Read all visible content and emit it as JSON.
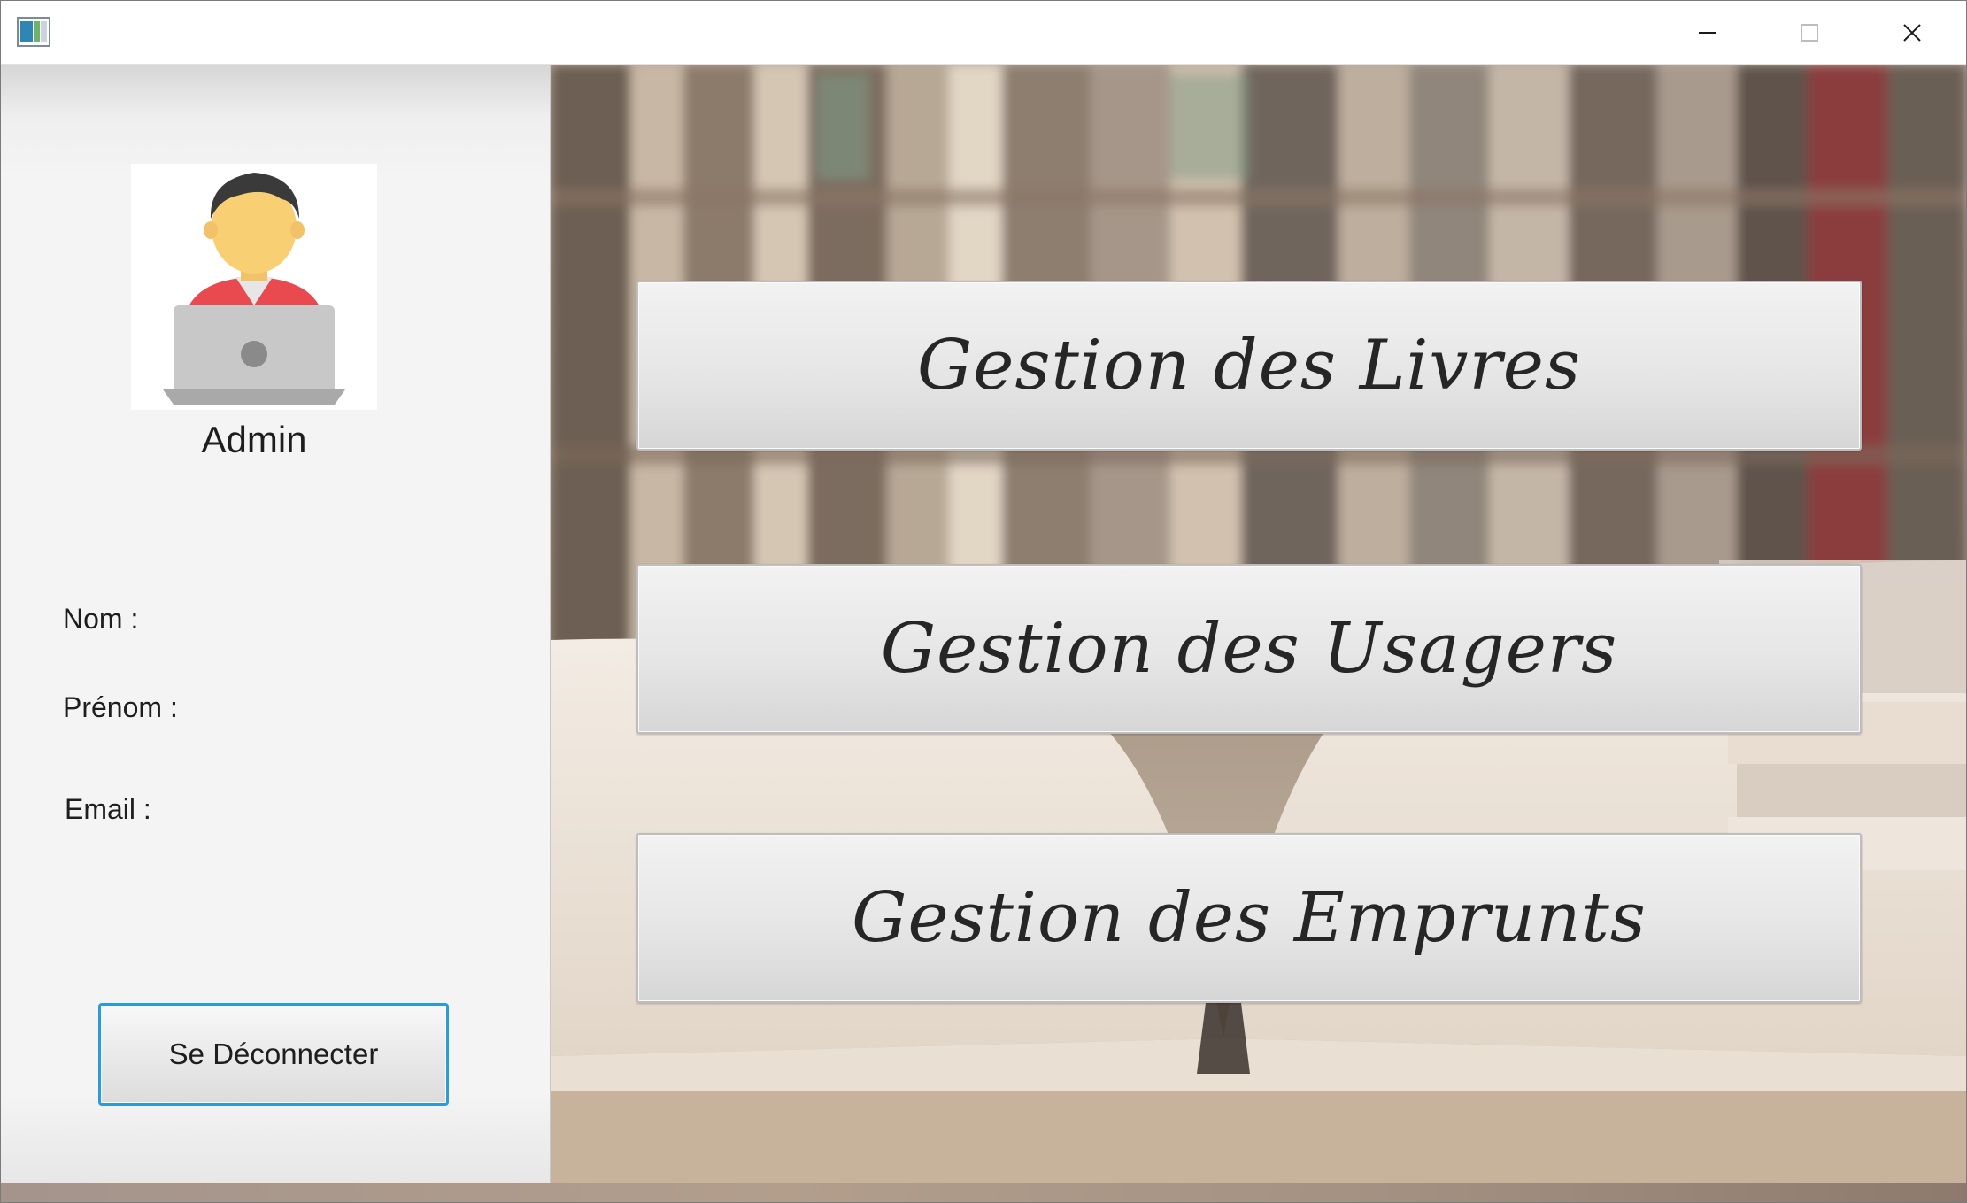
{
  "window": {
    "controls": {
      "minimize_icon": "minimize-icon",
      "maximize_icon": "maximize-icon",
      "close_icon": "close-icon"
    }
  },
  "sidebar": {
    "role": "Admin",
    "fields": {
      "nom_label": "Nom :",
      "prenom_label": "Prénom :",
      "email_label": "Email :"
    },
    "logout_label": "Se Déconnecter",
    "logout_border_color": "#2d9bd8"
  },
  "main": {
    "buttons": [
      {
        "label": "Gestion des Livres"
      },
      {
        "label": "Gestion des Usagers"
      },
      {
        "label": "Gestion des Emprunts"
      }
    ]
  }
}
